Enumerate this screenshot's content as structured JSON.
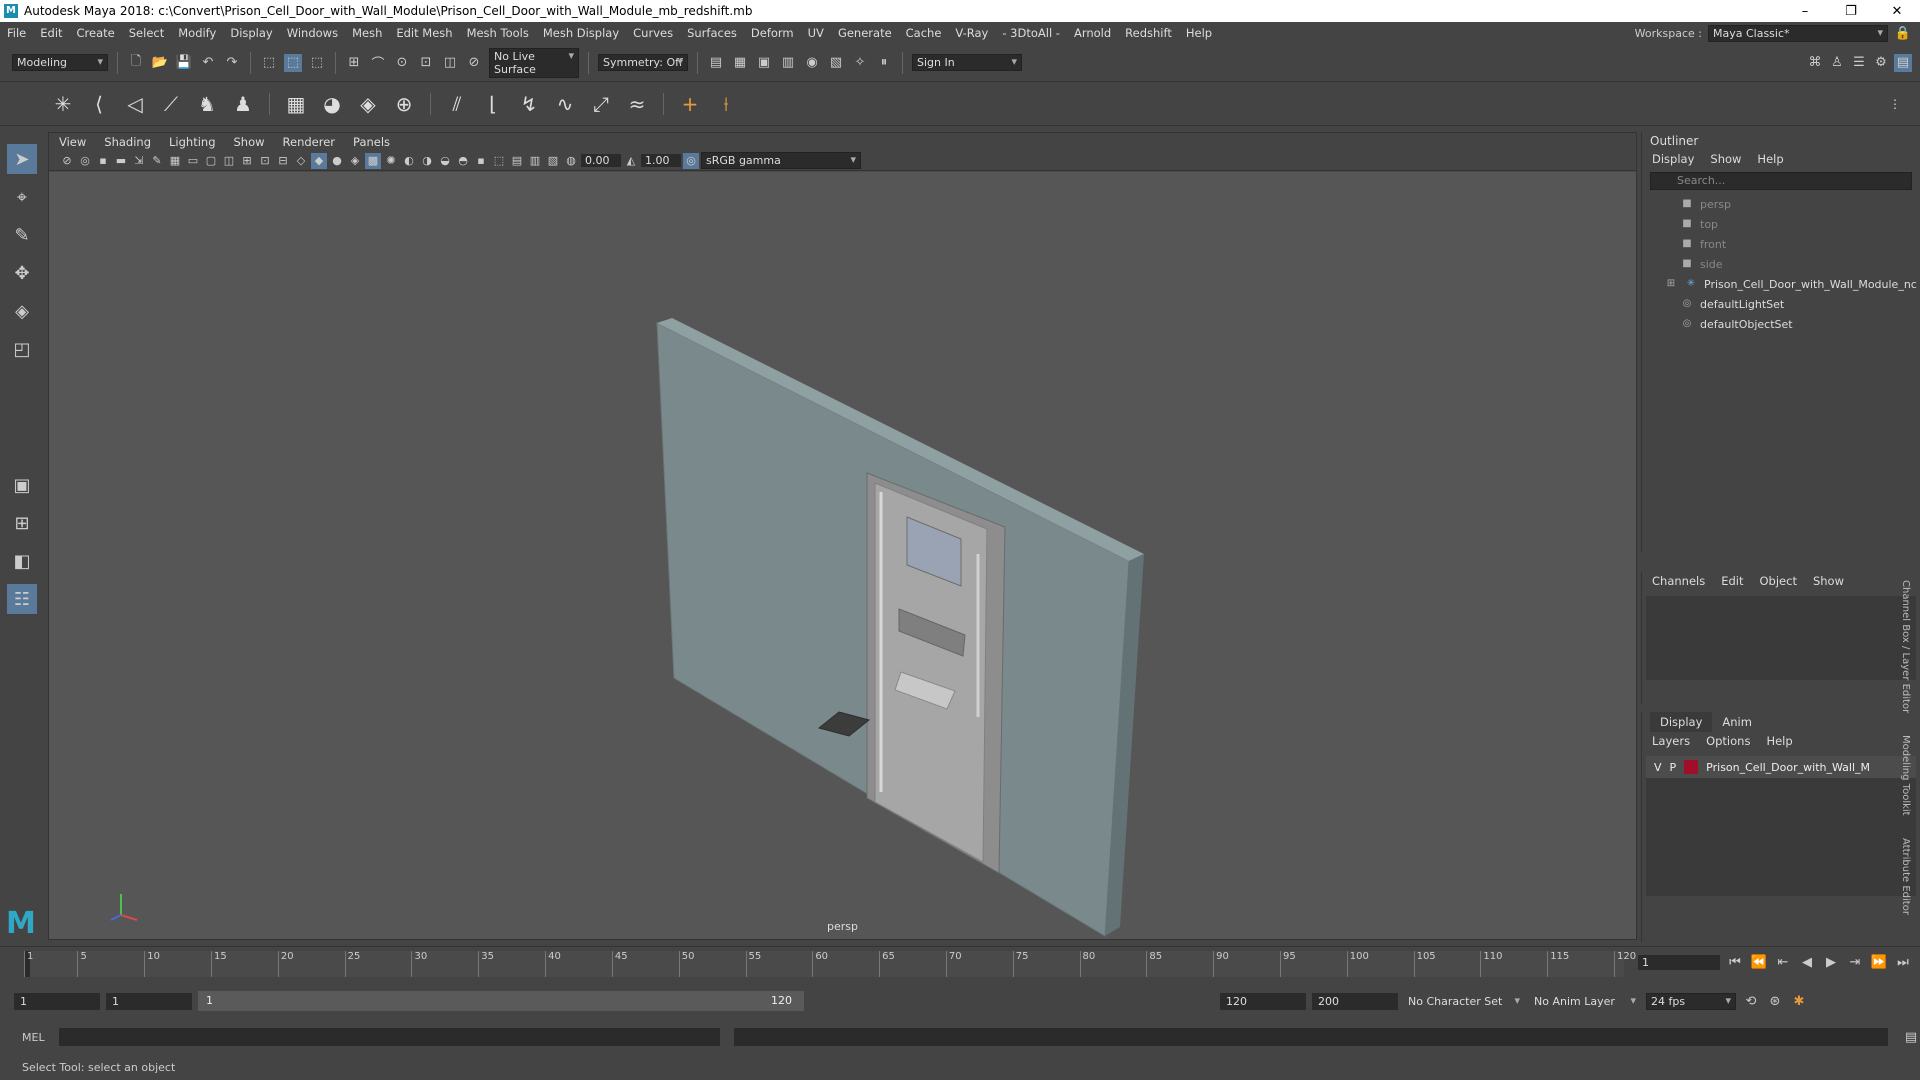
{
  "window": {
    "title": "Autodesk Maya 2018: c:\\Convert\\Prison_Cell_Door_with_Wall_Module\\Prison_Cell_Door_with_Wall_Module_mb_redshift.mb"
  },
  "menubar": {
    "items": [
      "File",
      "Edit",
      "Create",
      "Select",
      "Modify",
      "Display",
      "Windows",
      "Mesh",
      "Edit Mesh",
      "Mesh Tools",
      "Mesh Display",
      "Curves",
      "Surfaces",
      "Deform",
      "UV",
      "Generate",
      "Cache",
      "V-Ray",
      "- 3DtoAll -",
      "Arnold",
      "Redshift",
      "Help"
    ],
    "workspace_label": "Workspace :",
    "workspace_value": "Maya Classic*"
  },
  "statusline": {
    "mode": "Modeling",
    "live_surface": "No Live Surface",
    "symmetry": "Symmetry: Off",
    "sign_in": "Sign In"
  },
  "viewport": {
    "menu": [
      "View",
      "Shading",
      "Lighting",
      "Show",
      "Renderer",
      "Panels"
    ],
    "exposure": "0.00",
    "gamma": "1.00",
    "color_space": "sRGB gamma",
    "camera_label": "persp"
  },
  "outliner": {
    "title": "Outliner",
    "menu": [
      "Display",
      "Show",
      "Help"
    ],
    "search_placeholder": "Search...",
    "items": [
      {
        "label": "persp",
        "dim": true
      },
      {
        "label": "top",
        "dim": true
      },
      {
        "label": "front",
        "dim": true
      },
      {
        "label": "side",
        "dim": true
      },
      {
        "label": "Prison_Cell_Door_with_Wall_Module_nc",
        "dim": false
      },
      {
        "label": "defaultLightSet",
        "dim": false
      },
      {
        "label": "defaultObjectSet",
        "dim": false
      }
    ]
  },
  "channelbox": {
    "menu": [
      "Channels",
      "Edit",
      "Object",
      "Show"
    ]
  },
  "layer_editor": {
    "tabs": [
      "Display",
      "Anim"
    ],
    "menu": [
      "Layers",
      "Options",
      "Help"
    ],
    "layer": {
      "v": "V",
      "p": "P",
      "name": "Prison_Cell_Door_with_Wall_M",
      "color": "#a00e2a"
    }
  },
  "sidetabs": [
    "Channel Box / Layer Editor",
    "Modeling Toolkit",
    "Attribute Editor"
  ],
  "timeslider": {
    "ticks": [
      "1",
      "5",
      "10",
      "15",
      "20",
      "25",
      "30",
      "35",
      "40",
      "45",
      "50",
      "55",
      "60",
      "65",
      "70",
      "75",
      "80",
      "85",
      "90",
      "95",
      "100",
      "105",
      "110",
      "115",
      "120"
    ],
    "current_frame": "1"
  },
  "range": {
    "start": "1",
    "start2": "1",
    "bar_start": "1",
    "bar_end": "120",
    "end": "120",
    "end2": "200",
    "character_set": "No Character Set",
    "anim_layer": "No Anim Layer",
    "fps": "24 fps"
  },
  "cmdline": {
    "label": "MEL"
  },
  "helpline": {
    "text": "Select Tool: select an object"
  }
}
